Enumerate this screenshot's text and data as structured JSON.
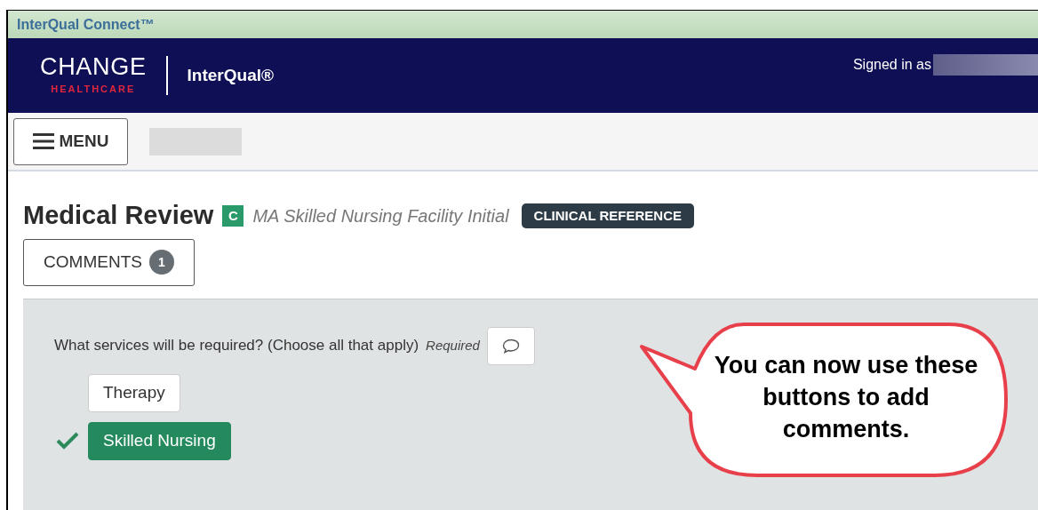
{
  "window": {
    "title": "InterQual Connect™"
  },
  "header": {
    "logo_top": "CHANGE",
    "logo_bottom": "HEALTHCARE",
    "product": "InterQual®",
    "signed_in": "Signed in as"
  },
  "toolbar": {
    "menu_label": "MENU"
  },
  "review": {
    "title": "Medical Review",
    "badge": "C",
    "subset": "MA Skilled Nursing Facility Initial",
    "tag": "CLINICAL REFERENCE",
    "comments_label": "COMMENTS",
    "comments_count": "1"
  },
  "question": {
    "text": "What services will be required? (Choose all that apply)",
    "required": "Required",
    "options": [
      {
        "label": "Therapy",
        "selected": false
      },
      {
        "label": "Skilled Nursing",
        "selected": true
      }
    ]
  },
  "callout": {
    "text": "You can now use these buttons to add comments."
  }
}
